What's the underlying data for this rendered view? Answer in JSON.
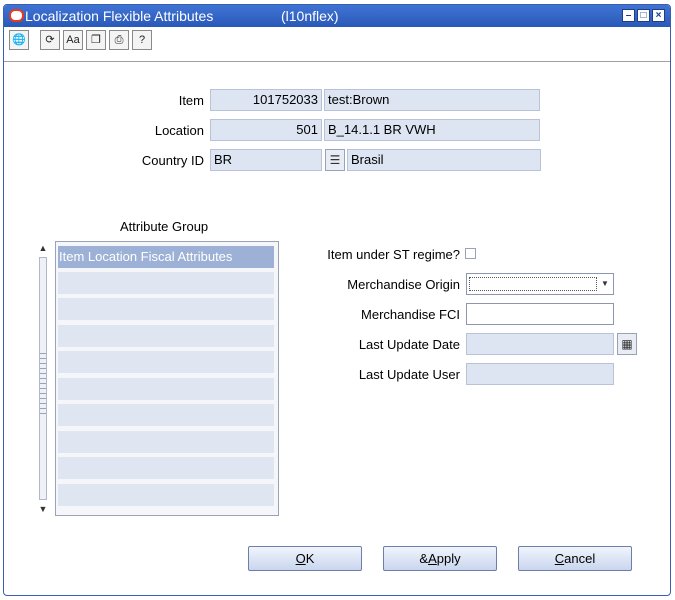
{
  "window": {
    "title": "Localization Flexible Attributes",
    "form_name": "(l10nflex)"
  },
  "toolbar": {
    "icons": [
      "globe-icon",
      "refresh-icon",
      "spell-check-icon",
      "copy-icon",
      "print-icon",
      "help-icon"
    ]
  },
  "header": {
    "item_label": "Item",
    "item_id": "101752033",
    "item_desc": "test:Brown",
    "location_label": "Location",
    "location_id": "501",
    "location_desc": "B_14.1.1 BR VWH",
    "country_label": "Country ID",
    "country_id": "BR",
    "country_desc": "Brasil"
  },
  "attribute_group": {
    "title": "Attribute Group",
    "items": [
      "Item Location Fiscal Attributes",
      "",
      "",
      "",
      "",
      "",
      "",
      "",
      "",
      ""
    ]
  },
  "attributes": {
    "st_regime_label": "Item under ST regime?",
    "st_regime_checked": false,
    "merch_origin_label": "Merchandise Origin",
    "merch_origin_value": "",
    "merch_fci_label": "Merchandise FCI",
    "merch_fci_value": "",
    "last_update_date_label": "Last Update Date",
    "last_update_date_value": "",
    "last_update_user_label": "Last Update User",
    "last_update_user_value": ""
  },
  "buttons": {
    "ok_mnemonic": "O",
    "ok_rest": "K",
    "apply_prefix": "&",
    "apply_mnemonic": "A",
    "apply_rest": "pply",
    "cancel_mnemonic": "C",
    "cancel_rest": "ancel"
  },
  "colors": {
    "titlebar": "#2a59b8",
    "field_readonly": "#dde5f3",
    "list_selected": "#9db0d5"
  }
}
